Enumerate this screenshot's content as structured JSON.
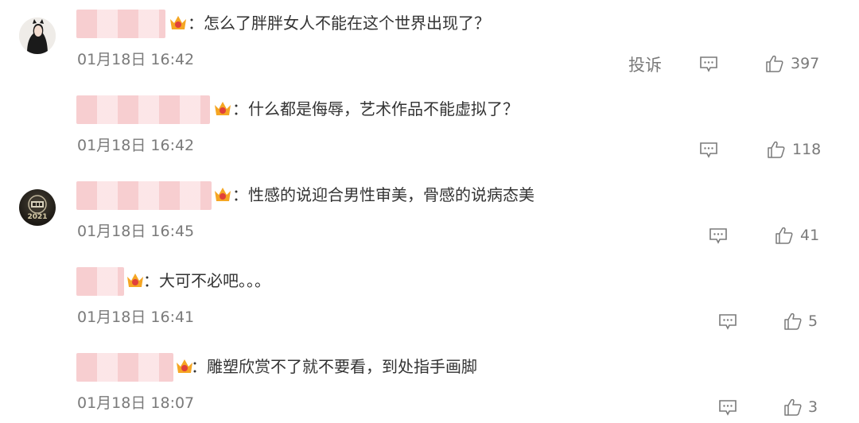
{
  "comments": [
    {
      "separator": "：",
      "text": "怎么了胖胖女人不能在这个世界出现了？",
      "date": "01月18日 16:42",
      "report": "投诉",
      "likes": "397",
      "reply_icon": "reply-icon",
      "like_icon": "thumbs-up-icon"
    },
    {
      "separator": "：",
      "text": "什么都是侮辱，艺术作品不能虚拟了？",
      "date": "01月18日 16:42",
      "likes": "118",
      "reply_icon": "reply-icon",
      "like_icon": "thumbs-up-icon"
    },
    {
      "separator": "：",
      "text": "性感的说迎合男性审美，骨感的说病态美",
      "date": "01月18日 16:45",
      "likes": "41",
      "reply_icon": "reply-icon",
      "like_icon": "thumbs-up-icon",
      "avatar_label": "2021"
    },
    {
      "separator": "：",
      "text": "大可不必吧。。。",
      "date": "01月18日 16:41",
      "likes": "5",
      "reply_icon": "reply-icon",
      "like_icon": "thumbs-up-icon"
    },
    {
      "separator": "：",
      "text": "雕塑欣赏不了就不要看，到处指手画脚",
      "date": "01月18日 18:07",
      "likes": "3",
      "reply_icon": "reply-icon",
      "like_icon": "thumbs-up-icon"
    }
  ],
  "colors": {
    "text": "#333333",
    "meta": "#7a7a7a",
    "badge_gold": "#f5a623",
    "badge_red": "#e0403a"
  }
}
